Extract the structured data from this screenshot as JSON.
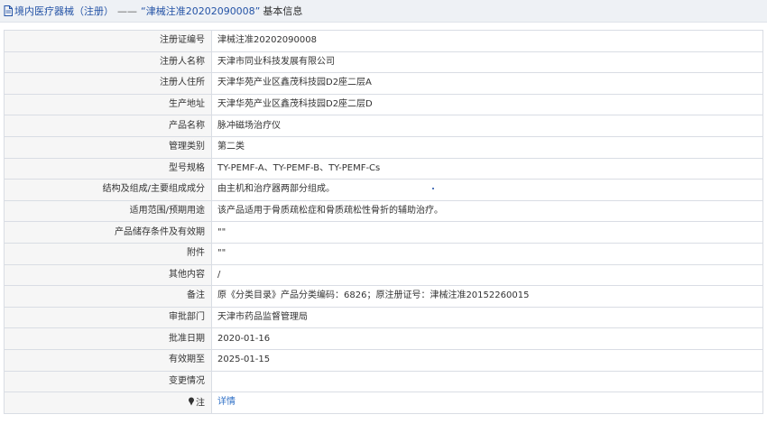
{
  "header": {
    "category": "境内医疗器械（注册）",
    "separator": "——",
    "reg_quoted": "“津械注准20202090008”",
    "suffix": "基本信息"
  },
  "rows": [
    {
      "label": "注册证编号",
      "value": "津械注准20202090008"
    },
    {
      "label": "注册人名称",
      "value": "天津市同业科技发展有限公司"
    },
    {
      "label": "注册人住所",
      "value": "天津华苑产业区鑫茂科技园D2座二层A"
    },
    {
      "label": "生产地址",
      "value": "天津华苑产业区鑫茂科技园D2座二层D"
    },
    {
      "label": "产品名称",
      "value": "脉冲磁场治疗仪"
    },
    {
      "label": "管理类别",
      "value": "第二类"
    },
    {
      "label": "型号规格",
      "value": "TY-PEMF-A、TY-PEMF-B、TY-PEMF-Cs"
    },
    {
      "label": "结构及组成/主要组成成分",
      "value": "由主机和治疗器两部分组成。"
    },
    {
      "label": "适用范围/预期用途",
      "value": "该产品适用于骨质疏松症和骨质疏松性骨折的辅助治疗。"
    },
    {
      "label": "产品储存条件及有效期",
      "value": "\"\""
    },
    {
      "label": "附件",
      "value": "\"\""
    },
    {
      "label": "其他内容",
      "value": "/"
    },
    {
      "label": "备注",
      "value": "原《分类目录》产品分类编码：6826；原注册证号：津械注准20152260015"
    },
    {
      "label": "审批部门",
      "value": "天津市药品监督管理局"
    },
    {
      "label": "批准日期",
      "value": "2020-01-16"
    },
    {
      "label": "有效期至",
      "value": "2025-01-15"
    },
    {
      "label": "变更情况",
      "value": ""
    }
  ],
  "note_row": {
    "label": "注",
    "link": "详情"
  },
  "colors": {
    "link": "#2e6fc6",
    "header_bg": "#eef1f5",
    "label_bg": "#f6f6f6",
    "border": "#d9dde4"
  }
}
